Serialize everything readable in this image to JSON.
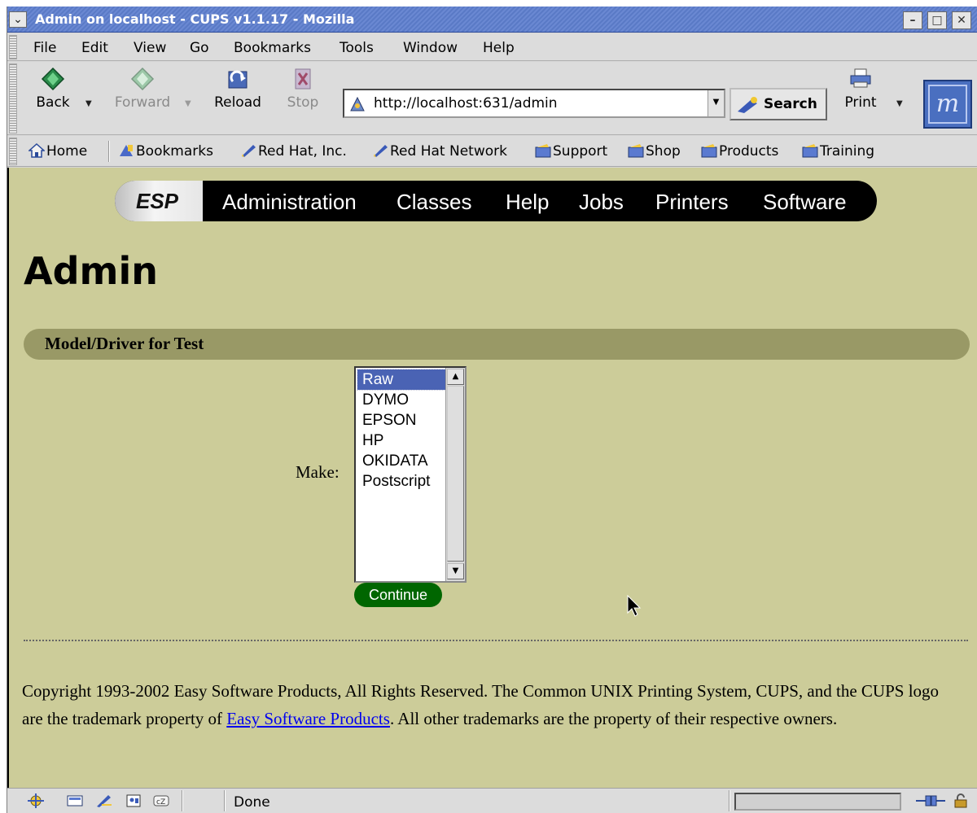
{
  "window": {
    "title": "Admin on localhost - CUPS v1.1.17 - Mozilla",
    "menu_icon": "chevron-down-icon",
    "minimize": "–",
    "maximize": "□",
    "close": "✕"
  },
  "menubar": {
    "items": [
      "File",
      "Edit",
      "View",
      "Go",
      "Bookmarks",
      "Tools",
      "Window",
      "Help"
    ]
  },
  "toolbar": {
    "back": "Back",
    "forward": "Forward",
    "reload": "Reload",
    "stop": "Stop",
    "url": "http://localhost:631/admin",
    "search": "Search",
    "print": "Print"
  },
  "bookmarks": {
    "items": [
      "Home",
      "Bookmarks",
      "Red Hat, Inc.",
      "Red Hat Network",
      "Support",
      "Shop",
      "Products",
      "Training"
    ]
  },
  "nav": {
    "brand": "ESP",
    "links": [
      "Administration",
      "Classes",
      "Help",
      "Jobs",
      "Printers",
      "Software"
    ]
  },
  "page": {
    "title": "Admin",
    "section": "Model/Driver for Test",
    "make_label": "Make:",
    "make_options": [
      "Raw",
      "DYMO",
      "EPSON",
      "HP",
      "OKIDATA",
      "Postscript"
    ],
    "selected_make": "Raw",
    "continue": "Continue"
  },
  "footer": {
    "text_before": "Copyright 1993-2002 Easy Software Products, All Rights Reserved. The Common UNIX Printing System, CUPS, and the CUPS logo are the trademark property of ",
    "link": "Easy Software Products",
    "text_after": ". All other trademarks are the property of their respective owners."
  },
  "status": {
    "text": "Done"
  },
  "colors": {
    "page_bg": "#cccc99",
    "section_bar": "#999966",
    "nav_bg": "#000000",
    "continue_bg": "#006600",
    "selection": "#4a63b4",
    "link": "#0000ee"
  }
}
